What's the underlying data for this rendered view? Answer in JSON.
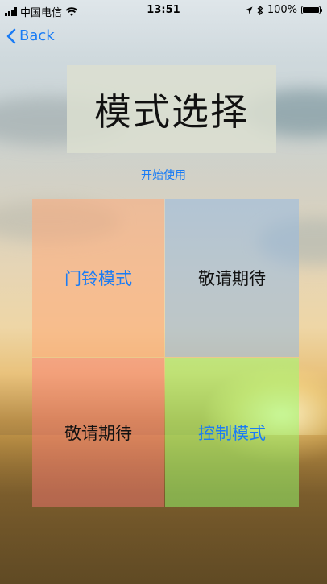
{
  "status_bar": {
    "carrier": "中国电信",
    "time": "13:51",
    "battery": "100%",
    "icons": [
      "signal-icon",
      "wifi-icon",
      "location-icon",
      "bluetooth-icon",
      "battery-icon"
    ]
  },
  "nav": {
    "back_label": "Back"
  },
  "title": "模式选择",
  "start_label": "开始使用",
  "tiles": [
    {
      "label": "门铃模式",
      "color": "#1a7cf5"
    },
    {
      "label": "敬请期待",
      "color": "#111111"
    },
    {
      "label": "敬请期待",
      "color": "#111111"
    },
    {
      "label": "控制模式",
      "color": "#1a7cf5"
    }
  ],
  "colors": {
    "accent": "#1a7cf5"
  }
}
